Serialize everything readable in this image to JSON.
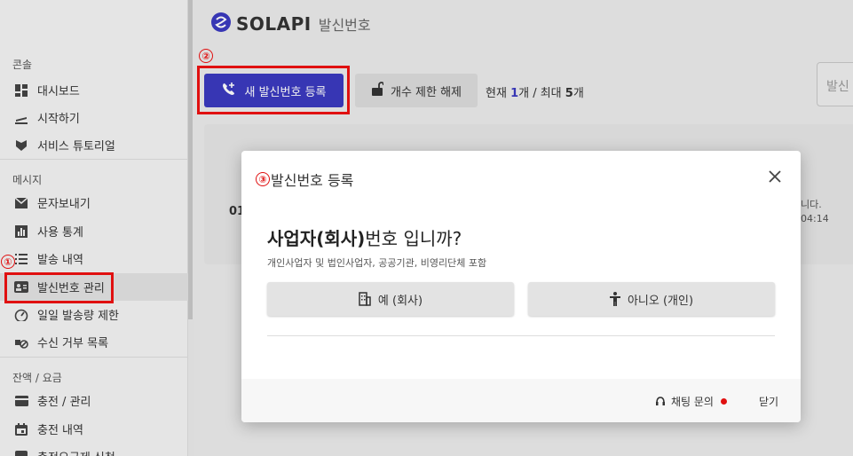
{
  "sidebar": {
    "sections": [
      {
        "label": "콘솔",
        "items": [
          {
            "label": "대시보드",
            "icon": "dashboard-icon"
          },
          {
            "label": "시작하기",
            "icon": "airplane-icon"
          },
          {
            "label": "서비스 튜토리얼",
            "icon": "tutorial-icon"
          }
        ]
      },
      {
        "label": "메시지",
        "items": [
          {
            "label": "문자보내기",
            "icon": "mail-icon"
          },
          {
            "label": "사용 통계",
            "icon": "stats-icon"
          },
          {
            "label": "발송 내역",
            "icon": "list-icon"
          },
          {
            "label": "발신번호 관리",
            "icon": "contact-card-icon"
          },
          {
            "label": "일일 발송량 제한",
            "icon": "gauge-icon"
          },
          {
            "label": "수신 거부 목록",
            "icon": "block-icon"
          }
        ]
      },
      {
        "label": "잔액 / 요금",
        "items": [
          {
            "label": "충전 / 관리",
            "icon": "card-icon"
          },
          {
            "label": "충전 내역",
            "icon": "calendar-icon"
          },
          {
            "label": "충전요금제 신청",
            "icon": "plan-icon"
          }
        ]
      }
    ]
  },
  "header": {
    "brand": "SOLAPI",
    "subtitle": "발신번호"
  },
  "toolbar": {
    "register_label": "새 발신번호 등록",
    "unlock_label": "개수 제한 해제",
    "count_prefix": "현재 ",
    "count_current": "1",
    "count_mid": "개 / 최대 ",
    "count_max": "5",
    "count_suffix": "개",
    "search_placeholder": "발신"
  },
  "table": {
    "row_id_fragment": "01",
    "right_text_1": "니다.",
    "right_text_2": "04:14"
  },
  "annotations": [
    "①",
    "②",
    "③"
  ],
  "modal": {
    "title": "발신번호 등록",
    "question_bold": "사업자(회사)",
    "question_rest": "번호 입니까?",
    "description": "개인사업자 및 법인사업자, 공공기관, 비영리단체 포함",
    "yes_label": "예 (회사)",
    "no_label": "아니오 (개인)",
    "chat_label": "채팅 문의",
    "close_label": "닫기"
  },
  "colors": {
    "primary": "#3b3ac0",
    "annotation": "#e01010"
  }
}
